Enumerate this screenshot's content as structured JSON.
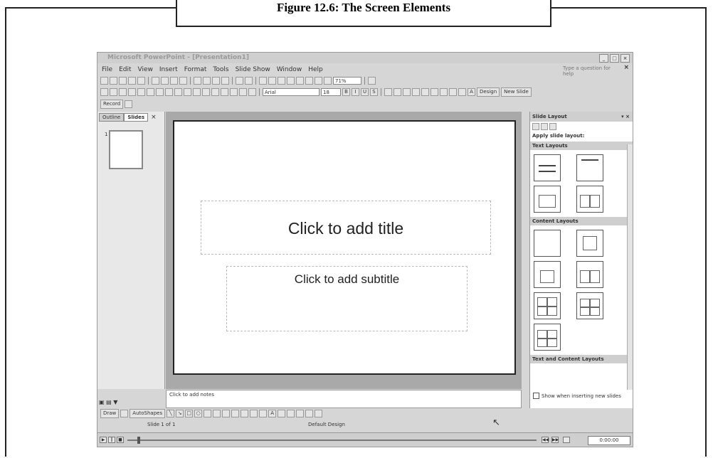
{
  "caption": "Figure 12.6: The Screen Elements",
  "app_title": "Microsoft PowerPoint - [Presentation1]",
  "menu": [
    "File",
    "Edit",
    "View",
    "Insert",
    "Format",
    "Tools",
    "Slide Show",
    "Window",
    "Help"
  ],
  "help_placeholder": "Type a question for help",
  "toolbar": {
    "zoom": "71%",
    "font": "Arial",
    "size": "18",
    "design": "Design",
    "new_slide": "New Slide",
    "record": "Record"
  },
  "pane_tabs": {
    "outline": "Outline",
    "slides": "Slides"
  },
  "thumb_number": "1",
  "slide": {
    "title_placeholder": "Click to add title",
    "subtitle_placeholder": "Click to add subtitle"
  },
  "notes_placeholder": "Click to add notes",
  "task_pane": {
    "title": "Slide Layout",
    "apply": "Apply slide layout:",
    "sections": {
      "text": "Text Layouts",
      "content": "Content Layouts",
      "text_content": "Text and Content Layouts"
    },
    "show_when": "Show when inserting new slides"
  },
  "drawing": {
    "draw": "Draw",
    "autoshapes": "AutoShapes"
  },
  "status": {
    "slide_of": "Slide 1 of 1",
    "design": "Default Design"
  },
  "timecode": "0:00:00"
}
